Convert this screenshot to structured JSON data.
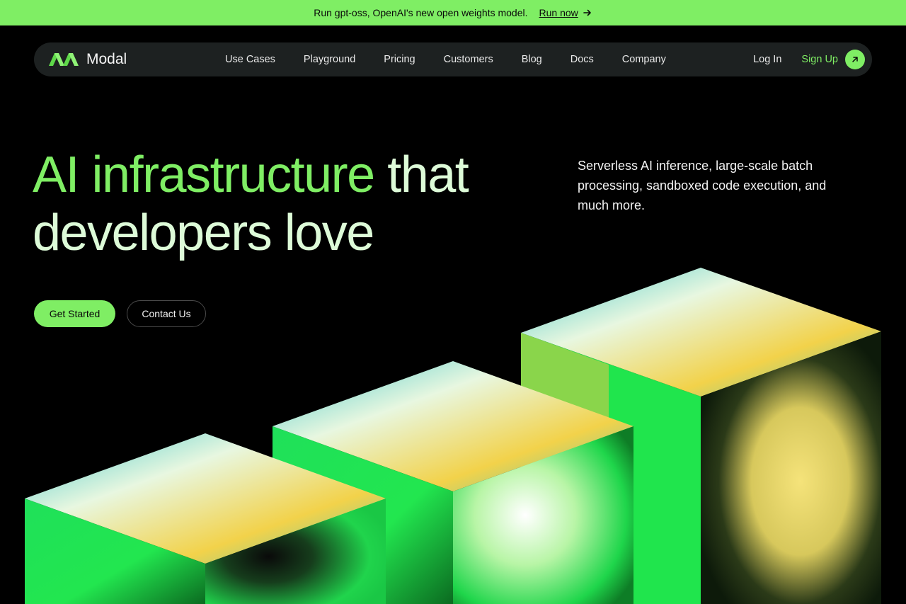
{
  "banner": {
    "message": "Run gpt-oss, OpenAI's new open weights model.",
    "link_label": "Run now",
    "icon": "arrow-right-icon"
  },
  "nav": {
    "brand": "Modal",
    "links": [
      "Use Cases",
      "Playground",
      "Pricing",
      "Customers",
      "Blog",
      "Docs",
      "Company"
    ],
    "login": "Log In",
    "signup": "Sign Up",
    "signup_icon": "arrow-up-right-icon"
  },
  "hero": {
    "title_accent": "AI infrastructure",
    "title_rest_line1": " that",
    "title_line2": "developers love",
    "description": "Serverless AI inference, large-scale batch processing, sandboxed code execution, and much more.",
    "cta_primary": "Get Started",
    "cta_secondary": "Contact Us"
  },
  "colors": {
    "accent": "#7fee64",
    "title": "#ddfbd8",
    "nav_bg": "#1d2121",
    "background": "#000000"
  }
}
